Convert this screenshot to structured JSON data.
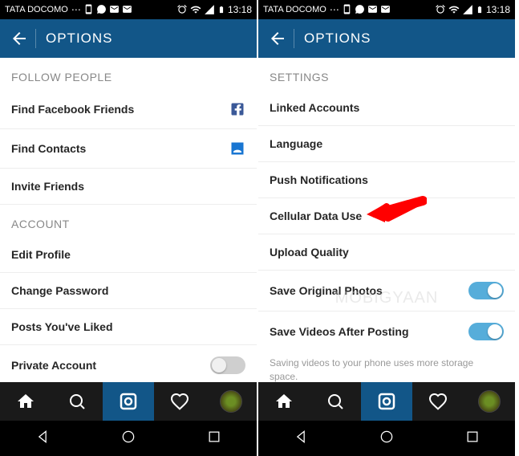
{
  "status": {
    "carrier": "TATA DOCOMO",
    "time": "13:18"
  },
  "left": {
    "title": "OPTIONS",
    "section1": "FOLLOW PEOPLE",
    "items1": {
      "facebook": "Find Facebook Friends",
      "contacts": "Find Contacts",
      "invite": "Invite Friends"
    },
    "section2": "ACCOUNT",
    "items2": {
      "edit": "Edit Profile",
      "password": "Change Password",
      "liked": "Posts You've Liked",
      "private": "Private Account"
    }
  },
  "right": {
    "title": "OPTIONS",
    "section": "SETTINGS",
    "items": {
      "linked": "Linked Accounts",
      "language": "Language",
      "push": "Push Notifications",
      "cellular": "Cellular Data Use",
      "upload": "Upload Quality",
      "saveOriginal": "Save Original Photos",
      "saveVideos": "Save Videos After Posting"
    },
    "subtext": "Saving videos to your phone uses more storage space."
  },
  "watermark": "MOBIGYAAN"
}
